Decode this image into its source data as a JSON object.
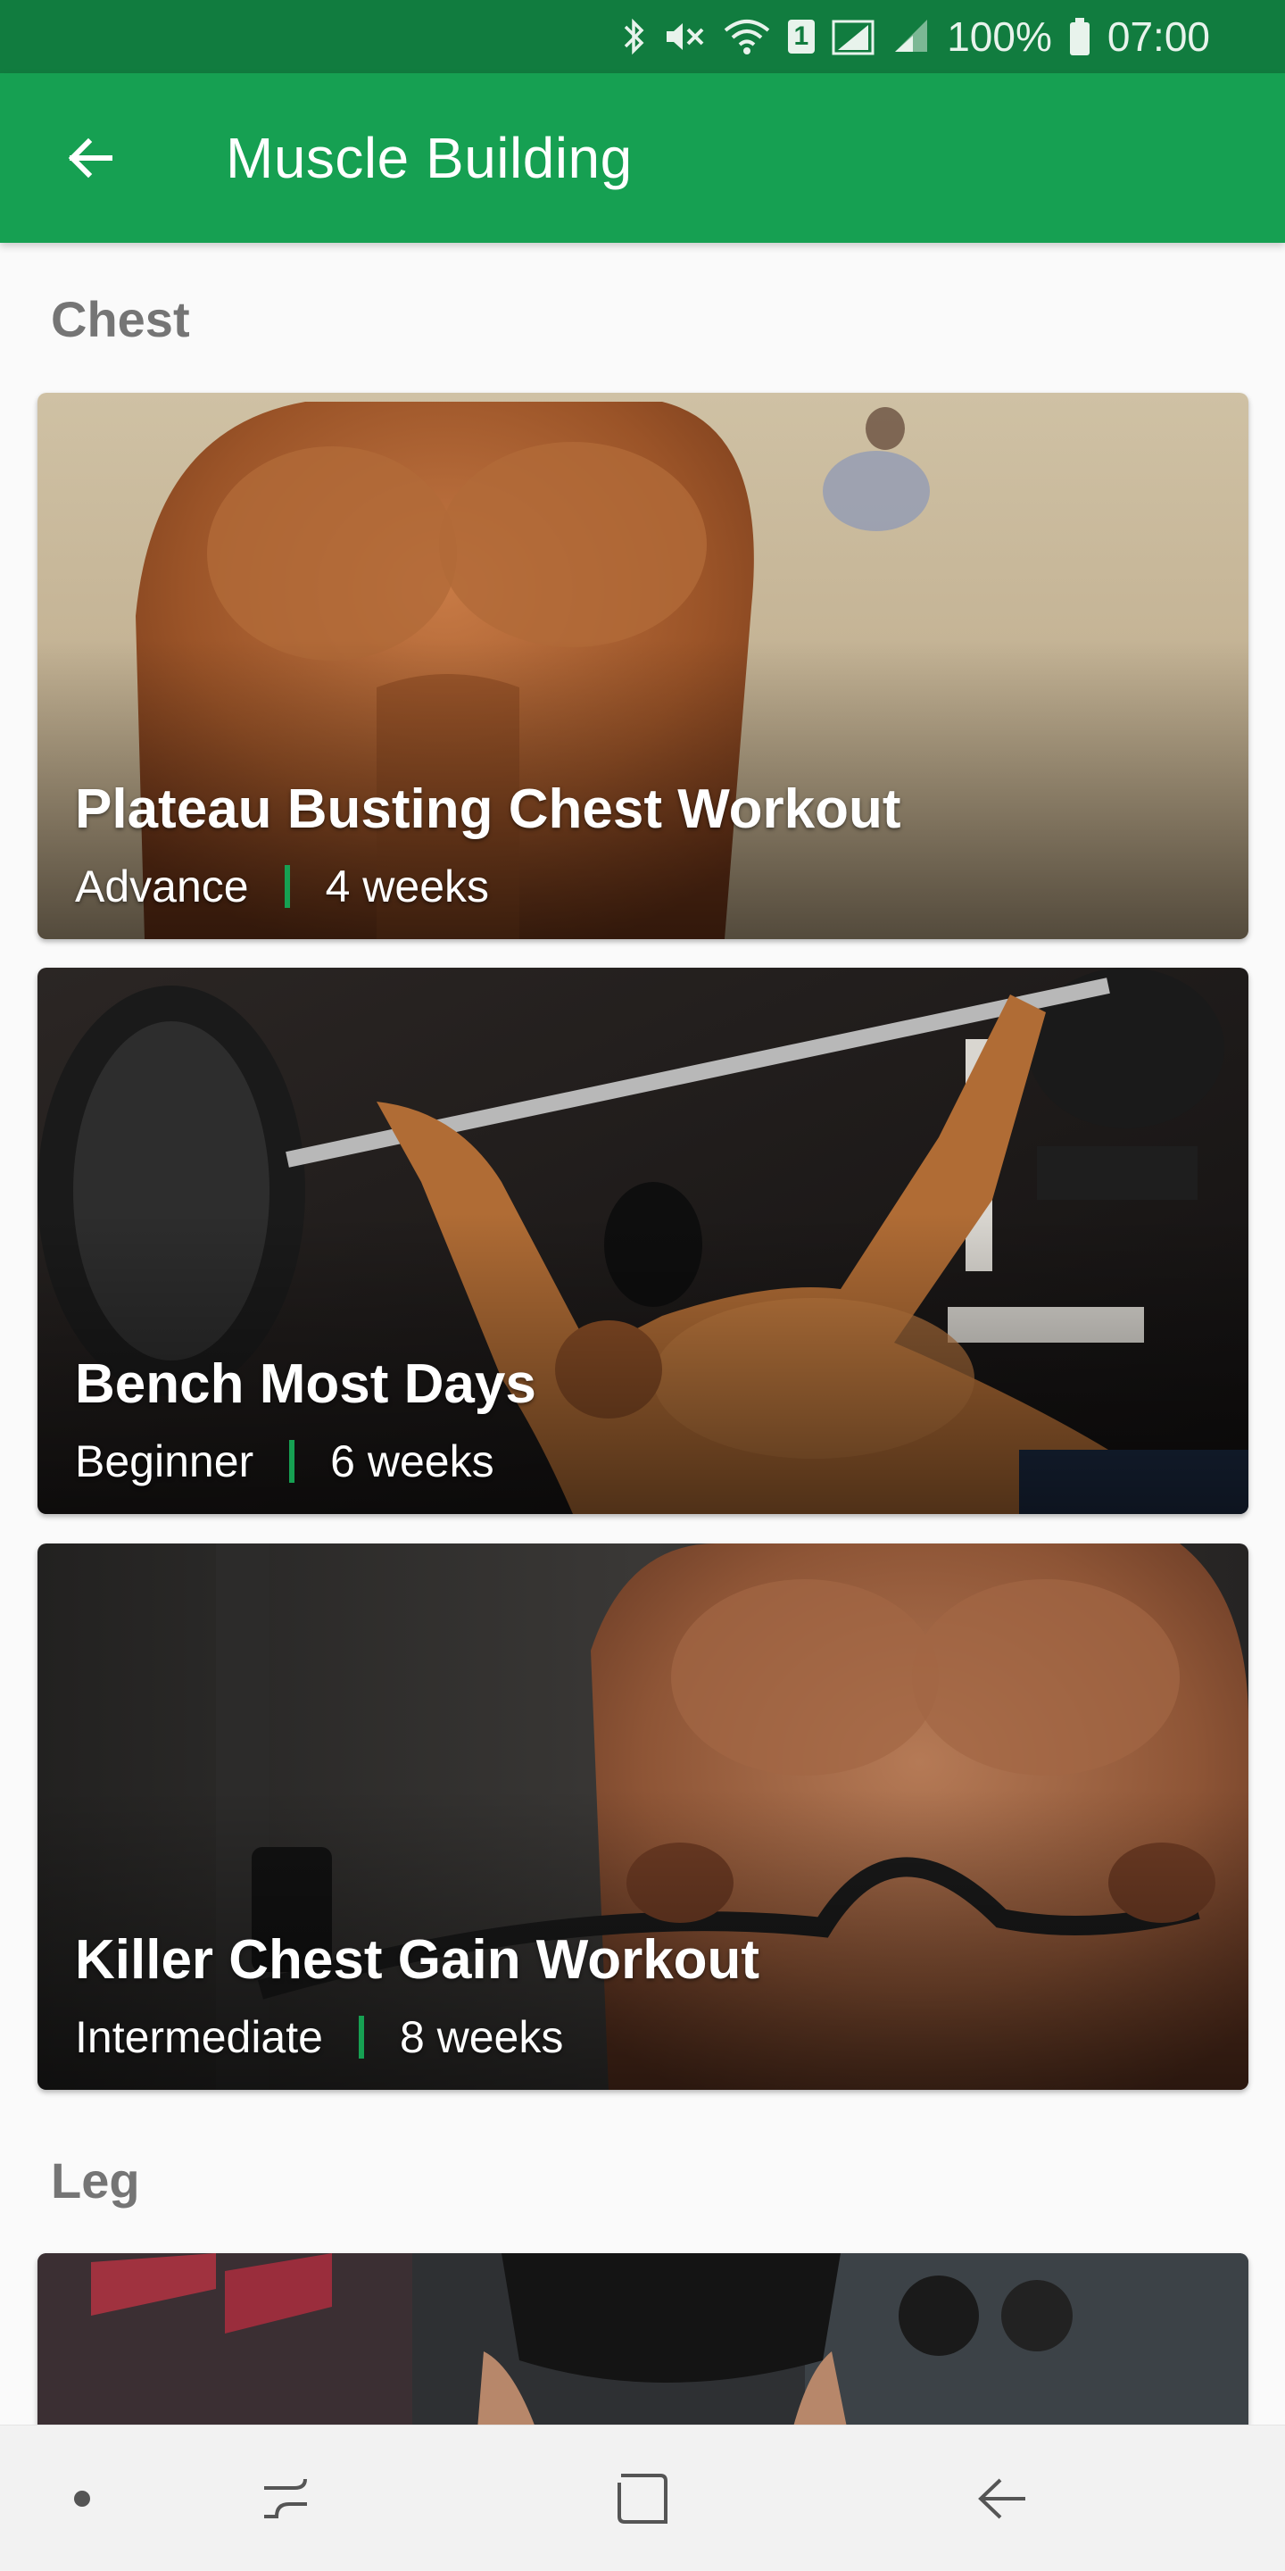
{
  "status_bar": {
    "battery_percent": "100%",
    "time": "07:00",
    "sim_badge": "1",
    "icons": [
      "bluetooth-icon",
      "mute-icon",
      "wifi-icon",
      "sim-badge-icon",
      "signal-icon",
      "signal-icon",
      "battery-icon"
    ]
  },
  "app_bar": {
    "title": "Muscle Building",
    "back_icon": "arrow-left-icon",
    "color": "#16a052"
  },
  "sections": [
    {
      "title": "Chest",
      "cards": [
        {
          "title": "Plateau Busting Chest Workout",
          "level": "Advance",
          "duration": "4 weeks"
        },
        {
          "title": "Bench Most Days",
          "level": "Beginner",
          "duration": "6 weeks"
        },
        {
          "title": "Killer Chest Gain Workout",
          "level": "Intermediate",
          "duration": "8 weeks"
        }
      ]
    },
    {
      "title": "Leg",
      "cards": []
    }
  ],
  "nav_bar": {
    "icons": [
      "dot-icon",
      "recent-apps-icon",
      "home-icon",
      "back-icon"
    ]
  },
  "colors": {
    "primary": "#16a052",
    "primary_dark": "#117c3f",
    "section_text": "#757575"
  }
}
